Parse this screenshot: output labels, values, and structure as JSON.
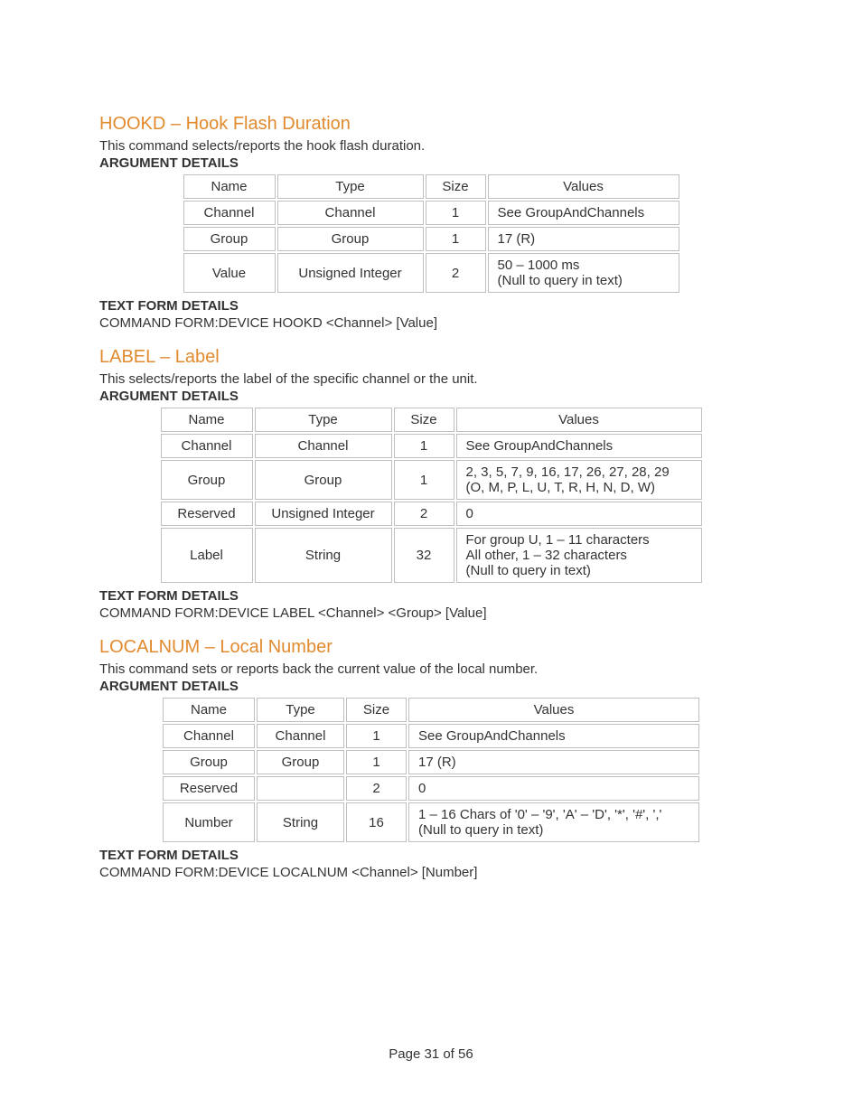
{
  "labels": {
    "argument_details": "ARGUMENT DETAILS",
    "text_form_details": "TEXT FORM DETAILS",
    "command_form_prefix": "COMMAND FORM:"
  },
  "footer": "Page 31 of 56",
  "sections": [
    {
      "id": "hookd",
      "title": "HOOKD – Hook Flash Duration",
      "desc": "This command selects/reports the hook flash duration.",
      "command_form": "DEVICE HOOKD <Channel> [Value]",
      "headers": [
        "Name",
        "Type",
        "Size",
        "Values"
      ],
      "rows": [
        {
          "c": [
            "Channel",
            "Channel",
            "1",
            "See GroupAndChannels"
          ]
        },
        {
          "c": [
            "Group",
            "Group",
            "1",
            "17 (R)"
          ]
        },
        {
          "c": [
            "Value",
            "Unsigned Integer",
            "2",
            "50 – 1000 ms\n(Null to query in text)"
          ]
        }
      ]
    },
    {
      "id": "label",
      "title": "LABEL – Label",
      "desc": "This selects/reports the label of the specific channel or the unit.",
      "command_form": "DEVICE LABEL <Channel> <Group> [Value]",
      "headers": [
        "Name",
        "Type",
        "Size",
        "Values"
      ],
      "rows": [
        {
          "c": [
            "Channel",
            "Channel",
            "1",
            "See GroupAndChannels"
          ]
        },
        {
          "c": [
            "Group",
            "Group",
            "1",
            "2, 3, 5, 7, 9, 16, 17, 26, 27, 28, 29\n(O, M, P, L, U, T, R, H, N, D, W)"
          ]
        },
        {
          "c": [
            "Reserved",
            "Unsigned Integer",
            "2",
            "0"
          ]
        },
        {
          "c": [
            "Label",
            "String",
            "32",
            "For group U, 1 – 11 characters\nAll other, 1 – 32 characters\n(Null to query in text)"
          ]
        }
      ]
    },
    {
      "id": "localnum",
      "title": "LOCALNUM – Local Number",
      "desc": "This command sets or reports back the current value of the local number.",
      "command_form": "DEVICE LOCALNUM <Channel> [Number]",
      "headers": [
        "Name",
        "Type",
        "Size",
        "Values"
      ],
      "rows": [
        {
          "c": [
            "Channel",
            "Channel",
            "1",
            "See GroupAndChannels"
          ]
        },
        {
          "c": [
            "Group",
            "Group",
            "1",
            "17 (R)"
          ]
        },
        {
          "c": [
            "Reserved",
            "",
            "2",
            "0"
          ]
        },
        {
          "c": [
            "Number",
            "String",
            "16",
            "1 – 16 Chars of '0' – '9', 'A' – 'D', '*', '#', ','\n(Null to query in text)"
          ]
        }
      ]
    }
  ]
}
